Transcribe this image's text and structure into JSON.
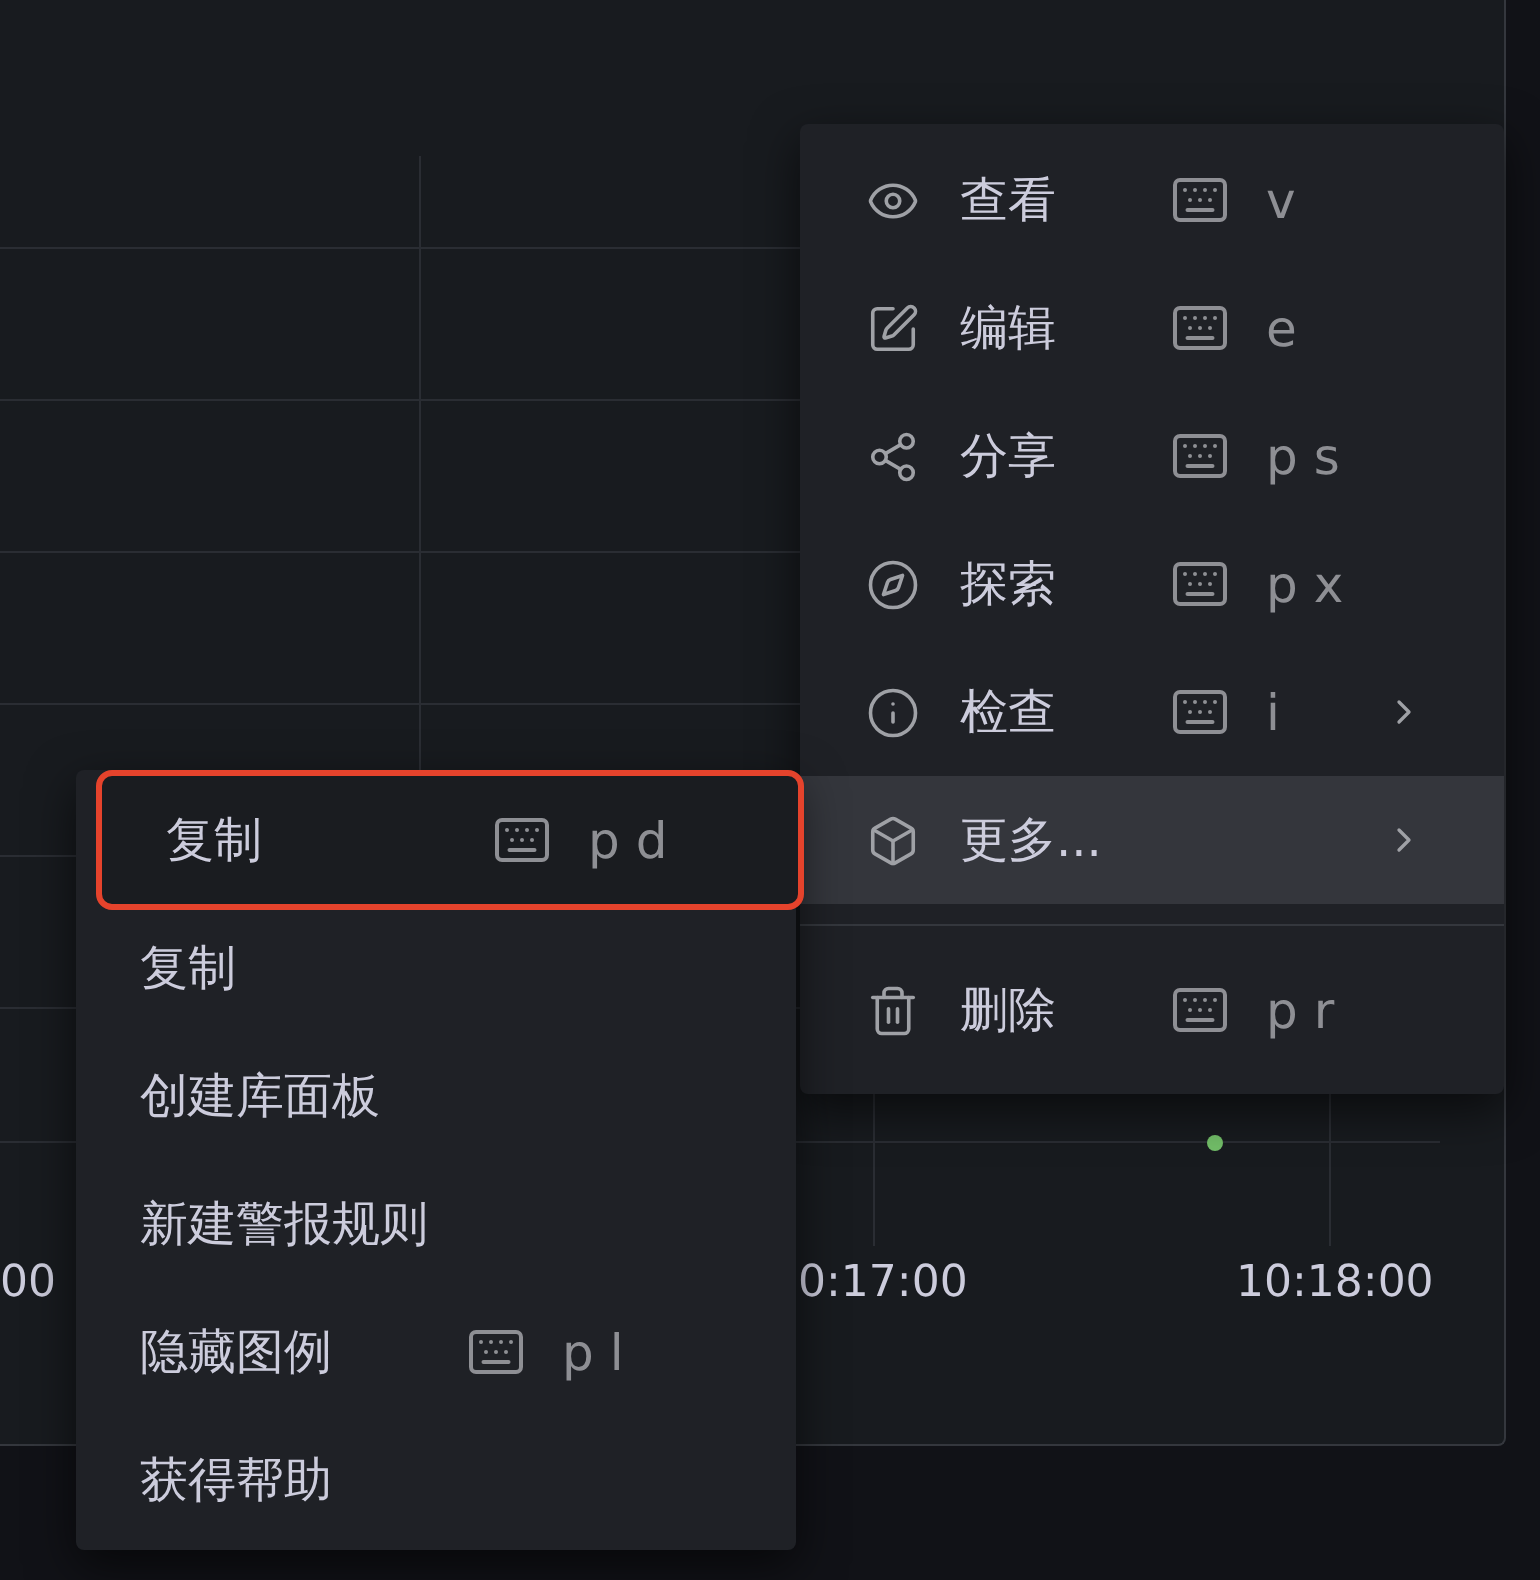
{
  "chart": {
    "x_axis_labels": [
      "00",
      "0:17:00",
      "10:18:00"
    ],
    "point": {
      "color": "#73bf69"
    }
  },
  "menu": {
    "items": [
      {
        "kind": "action",
        "label": "查看",
        "shortcut": "v",
        "has_submenu": false,
        "selected": false
      },
      {
        "kind": "action",
        "label": "编辑",
        "shortcut": "e",
        "has_submenu": false,
        "selected": false
      },
      {
        "kind": "action",
        "label": "分享",
        "shortcut": "p s",
        "has_submenu": false,
        "selected": false
      },
      {
        "kind": "action",
        "label": "探索",
        "shortcut": "p x",
        "has_submenu": false,
        "selected": false
      },
      {
        "kind": "action",
        "label": "检查",
        "shortcut": "i",
        "has_submenu": true,
        "selected": false
      },
      {
        "kind": "action",
        "label": "更多...",
        "has_submenu": true,
        "selected": true
      },
      {
        "kind": "divider"
      },
      {
        "kind": "action",
        "label": "删除",
        "shortcut": "p r",
        "has_submenu": false,
        "selected": false
      }
    ]
  },
  "submenu": {
    "items": [
      {
        "label": "复制",
        "shortcut": "p d",
        "focused": true
      },
      {
        "label": "复制",
        "focused": false
      },
      {
        "label": "创建库面板",
        "focused": false
      },
      {
        "label": "新建警报规则",
        "focused": false
      },
      {
        "label": "隐藏图例",
        "shortcut": "p l",
        "focused": false
      },
      {
        "label": "获得帮助",
        "focused": false
      }
    ]
  }
}
